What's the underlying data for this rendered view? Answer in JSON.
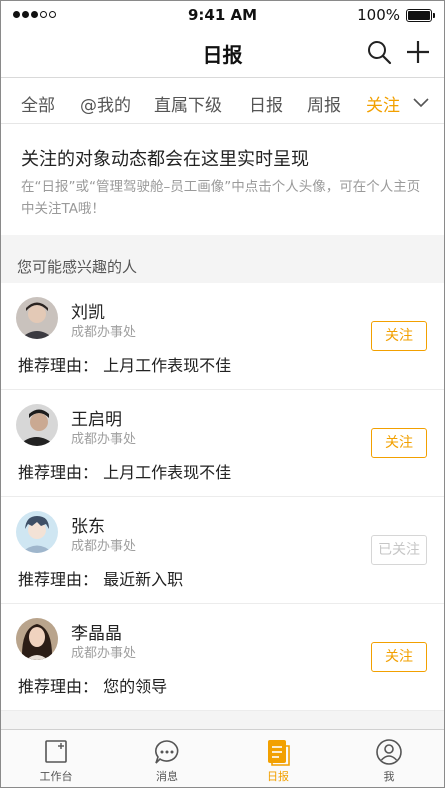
{
  "status_bar": {
    "time": "9:41 AM",
    "battery": "100%"
  },
  "nav": {
    "title": "日报",
    "icons": [
      "search-icon",
      "add-icon"
    ]
  },
  "tabs": [
    {
      "label": "全部",
      "active": false
    },
    {
      "label": "@我的",
      "active": false
    },
    {
      "label": "直属下级",
      "active": false
    },
    {
      "label": "日报",
      "active": false
    },
    {
      "label": "周报",
      "active": false
    },
    {
      "label": "关注",
      "active": true
    }
  ],
  "intro": {
    "title": "关注的对象动态都会在这里实时呈现",
    "description": "在“日报”或“管理驾驶舱–员工画像”中点击个人头像，可在个人主页中关注TA哦！"
  },
  "section": {
    "title": "您可能感兴趣的人"
  },
  "people": [
    {
      "name": "刘凯",
      "office": "成都办事处",
      "reason": "推荐理由：  上月工作表现不佳",
      "button": "关注",
      "followed": false
    },
    {
      "name": "王启明",
      "office": "成都办事处",
      "reason": "推荐理由：  上月工作表现不佳",
      "button": "关注",
      "followed": false
    },
    {
      "name": "张东",
      "office": "成都办事处",
      "reason": "推荐理由：  最近新入职",
      "button": "已关注",
      "followed": true
    },
    {
      "name": "李晶晶",
      "office": "成都办事处",
      "reason": "推荐理由：  您的领导",
      "button": "关注",
      "followed": false
    }
  ],
  "tabbar": [
    {
      "label": "工作台",
      "icon": "workbench-icon",
      "active": false
    },
    {
      "label": "消息",
      "icon": "message-icon",
      "active": false
    },
    {
      "label": "日报",
      "icon": "daily-report-icon",
      "active": true
    },
    {
      "label": "我",
      "icon": "profile-icon",
      "active": false
    }
  ],
  "colors": {
    "accent": "#f2a000",
    "muted": "#9a9a9a",
    "section_bg": "#f4f4f4"
  }
}
